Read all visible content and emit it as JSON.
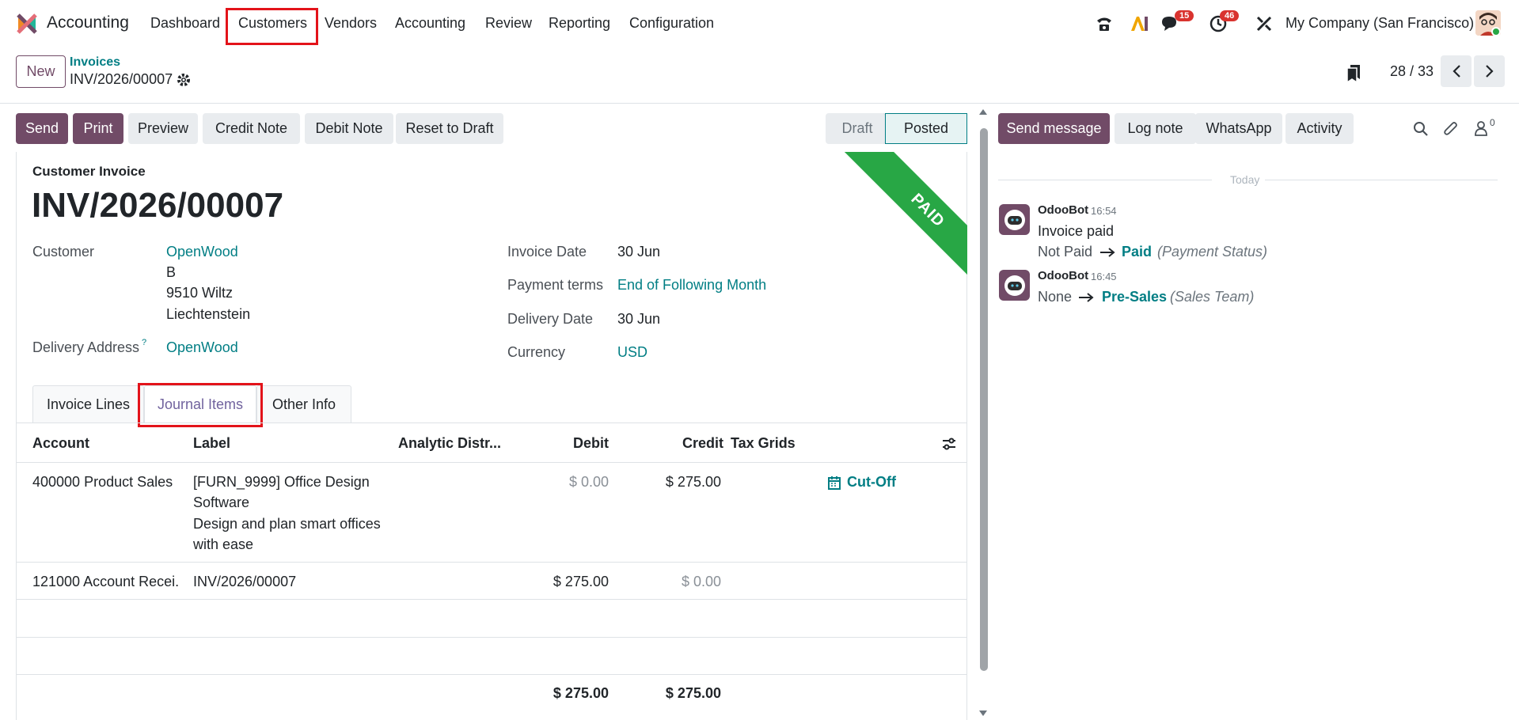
{
  "app": {
    "name": "Accounting"
  },
  "topnav": {
    "menus": [
      "Dashboard",
      "Customers",
      "Vendors",
      "Accounting",
      "Review",
      "Reporting",
      "Configuration"
    ],
    "messages_badge": "15",
    "activity_badge": "46",
    "company": "My Company (San Francisco)"
  },
  "control": {
    "new_label": "New",
    "breadcrumb_parent": "Invoices",
    "breadcrumb_current": "INV/2026/00007",
    "pager": "28 / 33"
  },
  "actions": {
    "send": "Send",
    "print": "Print",
    "preview": "Preview",
    "credit_note": "Credit Note",
    "debit_note": "Debit Note",
    "reset_to_draft": "Reset to Draft"
  },
  "status": {
    "draft": "Draft",
    "posted": "Posted",
    "ribbon": "PAID"
  },
  "invoice": {
    "type": "Customer Invoice",
    "number": "INV/2026/00007",
    "customer_label": "Customer",
    "customer": "OpenWood",
    "address_line1": "B",
    "address_line2": "9510 Wiltz",
    "address_line3": "Liechtenstein",
    "delivery_address_label": "Delivery Address",
    "delivery_address_hint": "?",
    "delivery_address": "OpenWood",
    "invoice_date_label": "Invoice Date",
    "invoice_date": "30 Jun",
    "payment_terms_label": "Payment terms",
    "payment_terms": "End of Following Month",
    "delivery_date_label": "Delivery Date",
    "delivery_date": "30 Jun",
    "currency_label": "Currency",
    "currency": "USD"
  },
  "tabs": [
    "Invoice Lines",
    "Journal Items",
    "Other Info"
  ],
  "journal": {
    "headers": [
      "Account",
      "Label",
      "Analytic Distr...",
      "Debit",
      "Credit",
      "Tax Grids"
    ],
    "rows": [
      {
        "account": "400000 Product Sales",
        "label_lines": [
          "[FURN_9999] Office Design",
          "Software",
          "Design and plan smart offices",
          "with ease"
        ],
        "debit": "$ 0.00",
        "credit": "$ 275.00",
        "action": "Cut-Off"
      },
      {
        "account": "121000 Account Recei...",
        "label_lines": [
          "INV/2026/00007"
        ],
        "debit": "$ 275.00",
        "credit": "$ 0.00",
        "action": ""
      }
    ],
    "total_debit": "$ 275.00",
    "total_credit": "$ 275.00"
  },
  "chatter": {
    "send_message": "Send message",
    "log_note": "Log note",
    "whatsapp": "WhatsApp",
    "activity": "Activity",
    "followers_count": "0",
    "today": "Today",
    "messages": [
      {
        "author": "OdooBot",
        "time": "16:54",
        "text": "Invoice paid",
        "from": "Not Paid",
        "to": "Paid",
        "field": "(Payment Status)"
      },
      {
        "author": "OdooBot",
        "time": "16:45",
        "text": "",
        "from": "None",
        "to": "Pre-Sales",
        "field": "(Sales Team)"
      }
    ]
  },
  "colors": {
    "brand": "#714b67",
    "link": "#017e84",
    "paid": "#28a745",
    "highlight": "#e3131a"
  }
}
